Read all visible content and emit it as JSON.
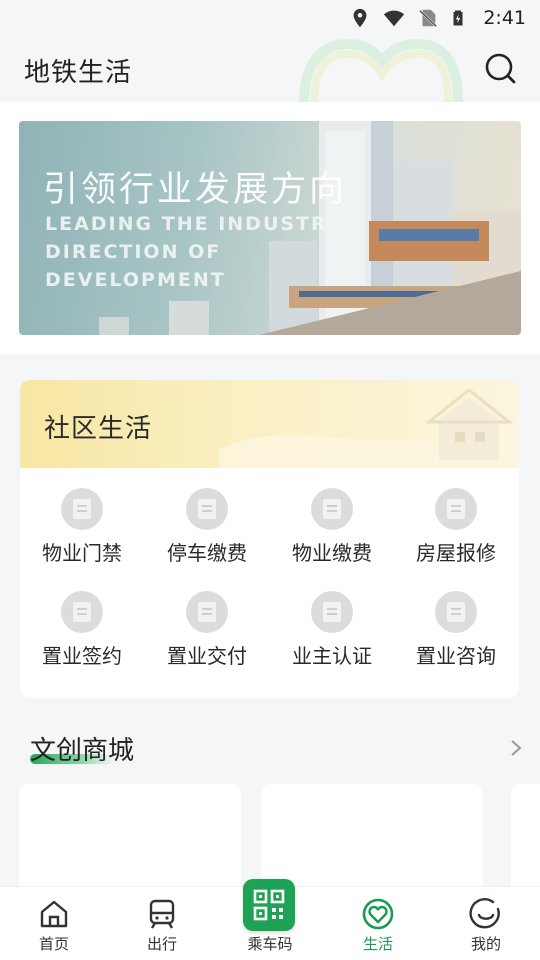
{
  "status_bar": {
    "time": "2:41"
  },
  "header": {
    "title": "地铁生活"
  },
  "banner": {
    "cn_text": "引领行业发展方向",
    "en_lines": [
      "LEADING THE INDUSTRY",
      "DIRECTION OF",
      "DEVELOPMENT"
    ]
  },
  "community": {
    "title": "社区生活",
    "items": [
      {
        "label": "物业门禁"
      },
      {
        "label": "停车缴费"
      },
      {
        "label": "物业缴费"
      },
      {
        "label": "房屋报修"
      },
      {
        "label": "置业签约"
      },
      {
        "label": "置业交付"
      },
      {
        "label": "业主认证"
      },
      {
        "label": "置业咨询"
      }
    ]
  },
  "mall": {
    "title": "文创商城"
  },
  "tabbar": {
    "active_color": "#1a9b52",
    "items": [
      {
        "label": "首页",
        "icon": "home-icon"
      },
      {
        "label": "出行",
        "icon": "train-icon"
      },
      {
        "label": "乘车码",
        "icon": "qr-code-icon"
      },
      {
        "label": "生活",
        "icon": "heart-icon"
      },
      {
        "label": "我的",
        "icon": "smile-icon"
      }
    ]
  }
}
